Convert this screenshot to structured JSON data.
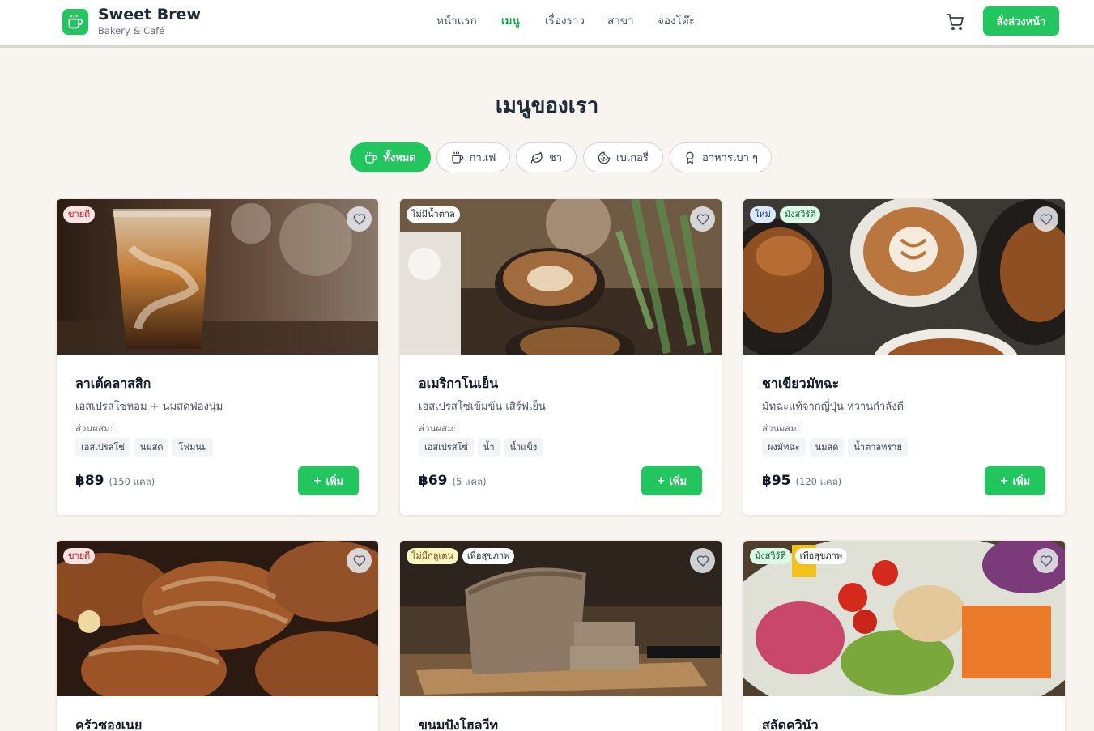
{
  "brand": {
    "name": "Sweet Brew",
    "subtitle": "Bakery & Café"
  },
  "nav": [
    {
      "label": "หน้าแรก",
      "active": false
    },
    {
      "label": "เมนู",
      "active": true
    },
    {
      "label": "เรื่องราว",
      "active": false
    },
    {
      "label": "สาขา",
      "active": false
    },
    {
      "label": "จองโต๊ะ",
      "active": false
    }
  ],
  "header": {
    "order_button": "สั่งล่วงหน้า",
    "cart_icon": "cart-icon"
  },
  "section": {
    "title": "เมนูของเรา"
  },
  "filters": [
    {
      "label": "ทั้งหมด",
      "icon": "cup-icon",
      "active": true
    },
    {
      "label": "กาแฟ",
      "icon": "coffee-icon",
      "active": false
    },
    {
      "label": "ชา",
      "icon": "leaf-icon",
      "active": false
    },
    {
      "label": "เบเกอรี่",
      "icon": "cookie-icon",
      "active": false
    },
    {
      "label": "อาหารเบา ๆ",
      "icon": "award-icon",
      "active": false
    }
  ],
  "ingredients_label": "ส่วนผสม:",
  "add_label": "เพิ่ม",
  "cards": [
    {
      "name": "ลาเต้คลาสสิก",
      "description": "เอสเปรสโซ่หอม + นมสดฟองนุ่ม",
      "ingredients": [
        "เอสเปรสโซ่",
        "นมสด",
        "โฟมนม"
      ],
      "price": "฿89",
      "calories": "(150 แคล)",
      "badges": [
        {
          "text": "ขายดี",
          "style": "red"
        }
      ]
    },
    {
      "name": "อเมริกาโนเย็น",
      "description": "เอสเปรสโซ่เข้มข้น เสิร์ฟเย็น",
      "ingredients": [
        "เอสเปรสโซ่",
        "น้ำ",
        "น้ำแข็ง"
      ],
      "price": "฿69",
      "calories": "(5 แคล)",
      "badges": [
        {
          "text": "ไม่มีน้ำตาล",
          "style": "white"
        }
      ]
    },
    {
      "name": "ชาเขียวมัทฉะ",
      "description": "มัทฉะแท้จากญี่ปุ่น หวานกำลังดี",
      "ingredients": [
        "ผงมัทฉะ",
        "นมสด",
        "น้ำตาลทราย"
      ],
      "price": "฿95",
      "calories": "(120 แคล)",
      "badges": [
        {
          "text": "ใหม่",
          "style": "blue"
        },
        {
          "text": "มังสวิรัติ",
          "style": "green"
        }
      ]
    },
    {
      "name": "ครัวซองเนย",
      "badges": [
        {
          "text": "ขายดี",
          "style": "red"
        }
      ]
    },
    {
      "name": "ขนมปังโฮลวีท",
      "badges": [
        {
          "text": "ไม่มีกลูเตน",
          "style": "yellow"
        },
        {
          "text": "เพื่อสุขภาพ",
          "style": "white"
        }
      ]
    },
    {
      "name": "สลัดควินัว",
      "badges": [
        {
          "text": "มังสวิรัติ",
          "style": "green"
        },
        {
          "text": "เพื่อสุขภาพ",
          "style": "white"
        }
      ]
    }
  ],
  "colors": {
    "accent": "#22c55e",
    "background": "#f8f5f1",
    "text": "#1f2937"
  }
}
